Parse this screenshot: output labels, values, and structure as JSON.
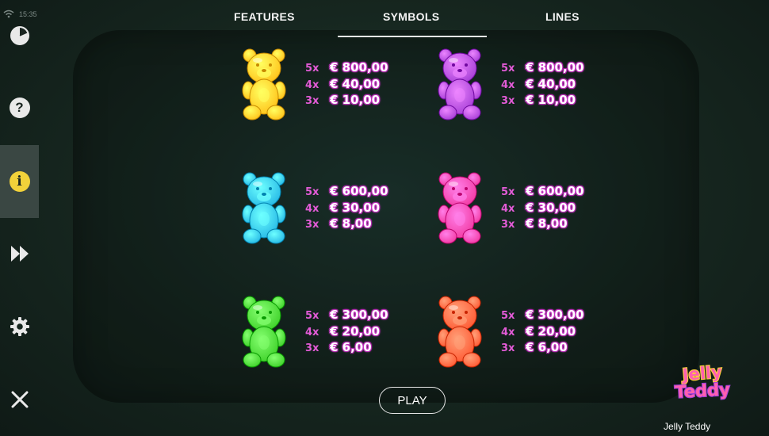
{
  "status_bar": {
    "time": "15:35"
  },
  "sidebar": {
    "items": [
      {
        "name": "history-icon"
      },
      {
        "name": "help-icon",
        "glyph": "?"
      },
      {
        "name": "info-icon",
        "glyph": "i",
        "active": true
      },
      {
        "name": "fast-forward-icon"
      },
      {
        "name": "settings-icon"
      },
      {
        "name": "close-icon"
      }
    ]
  },
  "tabs": [
    {
      "label": "FEATURES"
    },
    {
      "label": "SYMBOLS",
      "selected": true
    },
    {
      "label": "LINES"
    }
  ],
  "symbols": [
    {
      "color": "#ffc21a",
      "pays": [
        {
          "mult": "5x",
          "amount": "€ 800,00"
        },
        {
          "mult": "4x",
          "amount": "€ 40,00"
        },
        {
          "mult": "3x",
          "amount": "€ 10,00"
        }
      ]
    },
    {
      "color": "#a63fd6",
      "pays": [
        {
          "mult": "5x",
          "amount": "€ 800,00"
        },
        {
          "mult": "4x",
          "amount": "€ 40,00"
        },
        {
          "mult": "3x",
          "amount": "€ 10,00"
        }
      ]
    },
    {
      "color": "#27b9e6",
      "pays": [
        {
          "mult": "5x",
          "amount": "€ 600,00"
        },
        {
          "mult": "4x",
          "amount": "€ 30,00"
        },
        {
          "mult": "3x",
          "amount": "€ 8,00"
        }
      ]
    },
    {
      "color": "#f23aa3",
      "pays": [
        {
          "mult": "5x",
          "amount": "€ 600,00"
        },
        {
          "mult": "4x",
          "amount": "€ 30,00"
        },
        {
          "mult": "3x",
          "amount": "€ 8,00"
        }
      ]
    },
    {
      "color": "#3fd12a",
      "pays": [
        {
          "mult": "5x",
          "amount": "€ 300,00"
        },
        {
          "mult": "4x",
          "amount": "€ 20,00"
        },
        {
          "mult": "3x",
          "amount": "€ 6,00"
        }
      ]
    },
    {
      "color": "#ff5a33",
      "pays": [
        {
          "mult": "5x",
          "amount": "€ 300,00"
        },
        {
          "mult": "4x",
          "amount": "€ 20,00"
        },
        {
          "mult": "3x",
          "amount": "€ 6,00"
        }
      ]
    }
  ],
  "play_button": {
    "label": "PLAY"
  },
  "logo": {
    "line1": "Jelly",
    "line2": "Teddy"
  },
  "game_name": "Jelly Teddy"
}
